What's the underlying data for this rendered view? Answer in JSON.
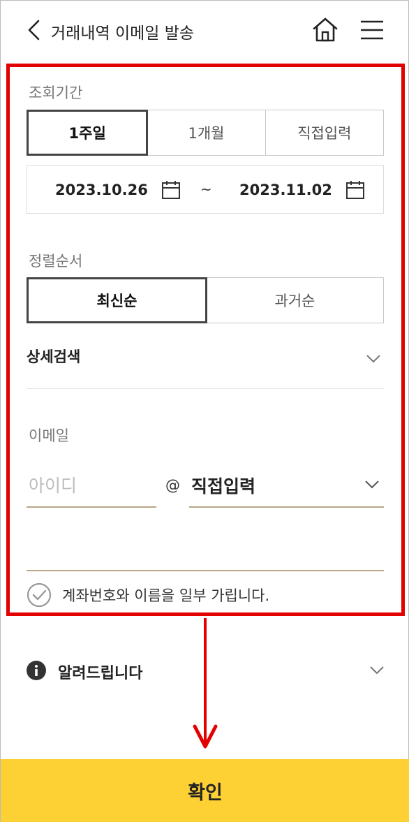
{
  "header": {
    "title": "거래내역 이메일 발송"
  },
  "period": {
    "label": "조회기간",
    "options": [
      "1주일",
      "1개월",
      "직접입력"
    ],
    "selected_index": 0,
    "start_date": "2023.10.26",
    "end_date": "2023.11.02",
    "separator": "~"
  },
  "sort": {
    "label": "정렬순서",
    "options": [
      "최신순",
      "과거순"
    ],
    "selected_index": 0
  },
  "detail_search": {
    "label": "상세검색"
  },
  "email": {
    "label": "이메일",
    "id_placeholder": "아이디",
    "at": "@",
    "domain_value": "직접입력"
  },
  "mask_option": {
    "label": "계좌번호와 이름을 일부 가립니다."
  },
  "notice": {
    "label": "알려드립니다"
  },
  "confirm_button": {
    "label": "확인"
  },
  "colors": {
    "accent_yellow": "#fdd034",
    "highlight_red": "#e30000",
    "underline_gold": "#b8a685"
  }
}
